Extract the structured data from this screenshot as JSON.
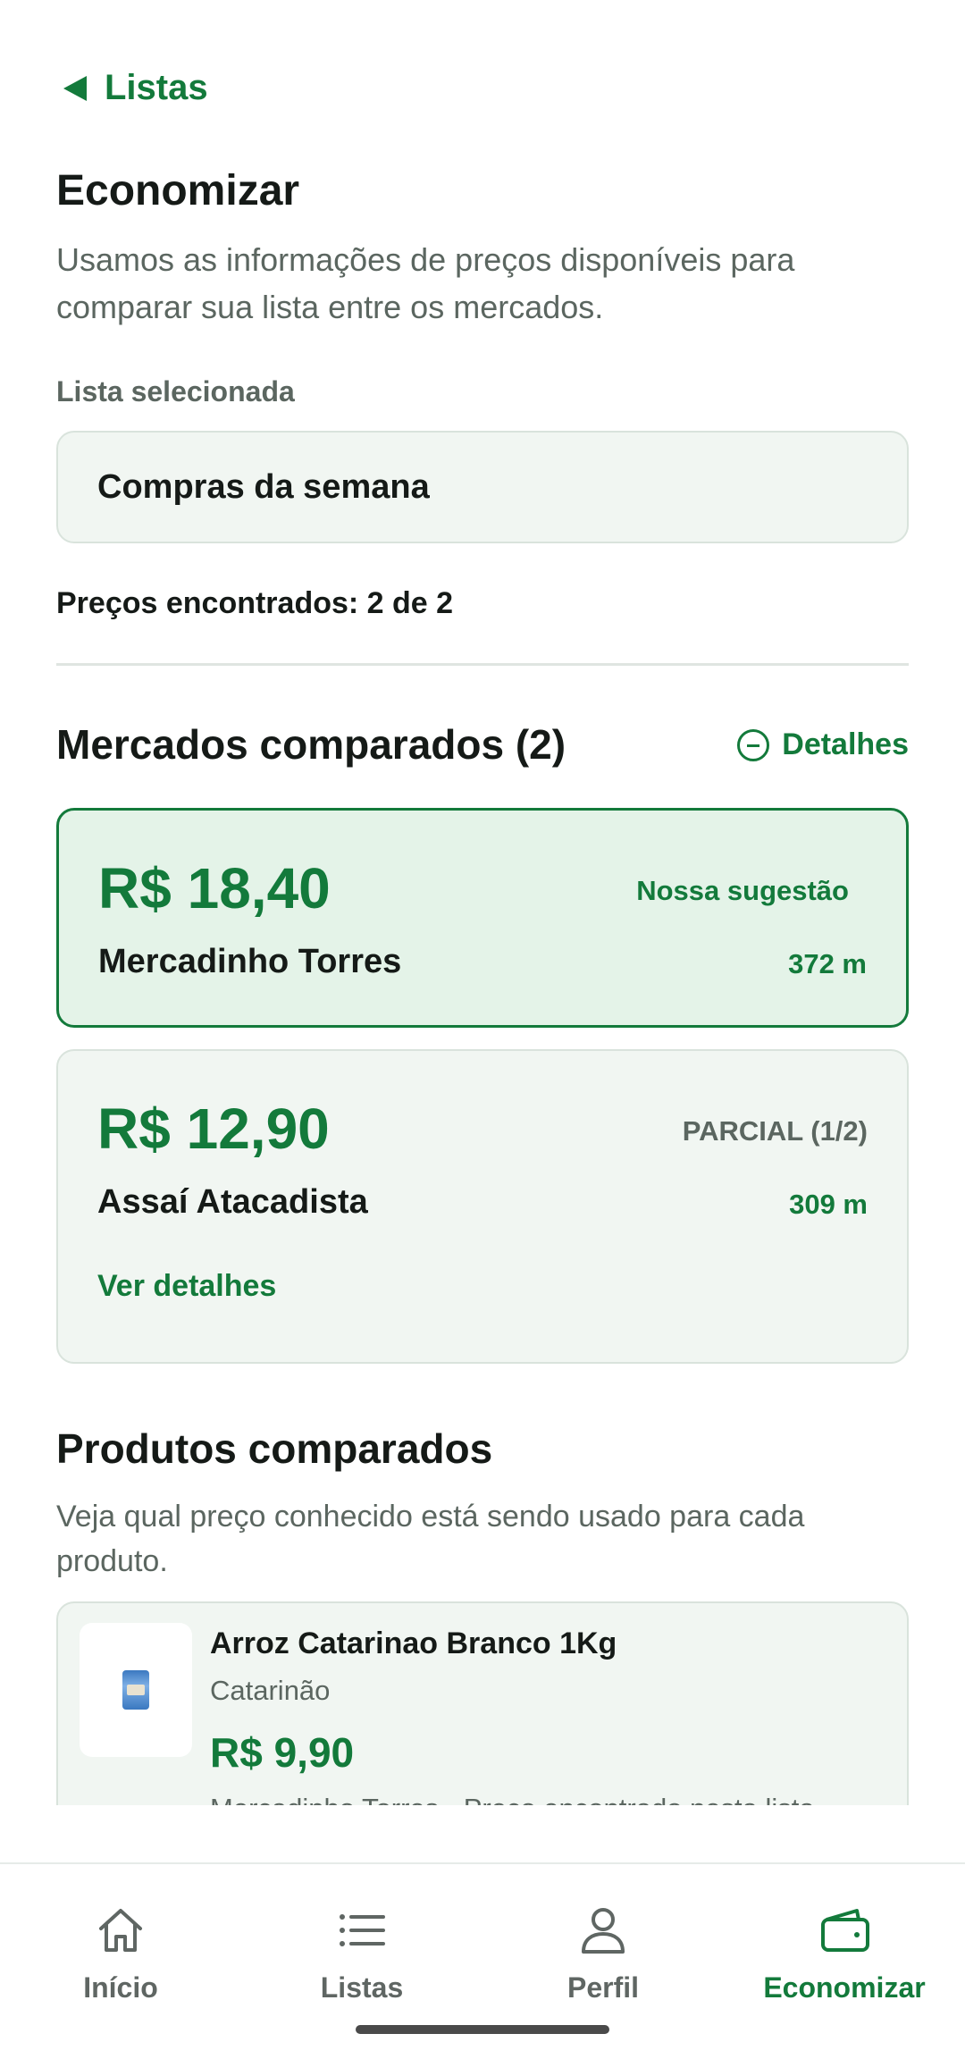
{
  "header": {
    "back_label": "Listas"
  },
  "page": {
    "title": "Economizar",
    "description": "Usamos as informações de preços disponíveis para comparar sua lista entre os mercados."
  },
  "list_select": {
    "label": "Lista selecionada",
    "value": "Compras da semana"
  },
  "prices_found": "Preços encontrados: 2 de 2",
  "markets_section": {
    "title": "Mercados comparados (2)",
    "details_label": "Detalhes",
    "cards": [
      {
        "price": "R$ 18,40",
        "tag": "Nossa sugestão",
        "name": "Mercadinho Torres",
        "distance": "372 m"
      },
      {
        "price": "R$ 12,90",
        "tag": "PARCIAL (1/2)",
        "name": "Assaí Atacadista",
        "distance": "309 m",
        "link": "Ver detalhes"
      }
    ]
  },
  "products_section": {
    "title": "Produtos comparados",
    "description": "Veja qual preço conhecido está sendo usado para cada produto.",
    "items": [
      {
        "name": "Arroz Catarinao Branco 1Kg",
        "brand": "Catarinão",
        "price": "R$ 9,90",
        "source": "Mercadinho Torres - Preço encontrado nesta lista -"
      }
    ]
  },
  "bottom_nav": {
    "items": [
      {
        "label": "Início",
        "icon": "home-icon"
      },
      {
        "label": "Listas",
        "icon": "list-icon"
      },
      {
        "label": "Perfil",
        "icon": "person-icon"
      },
      {
        "label": "Economizar",
        "icon": "wallet-icon",
        "active": true
      }
    ]
  },
  "colors": {
    "accent": "#137a3b",
    "card_bg": "#f1f6f2",
    "suggested_bg": "#e4f3e8",
    "muted_text": "#5b6660"
  }
}
